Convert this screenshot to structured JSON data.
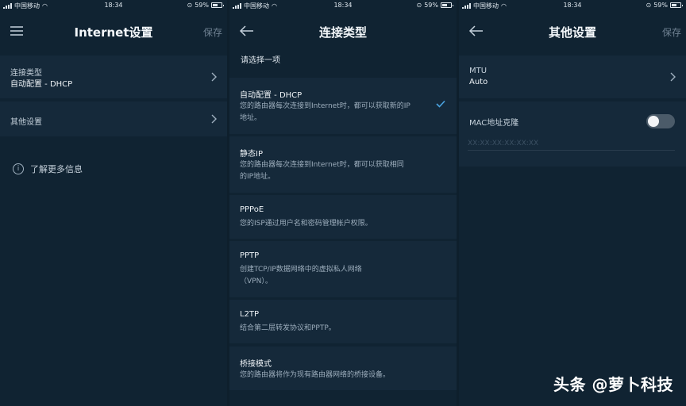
{
  "status_bar": {
    "carrier": "中国移动",
    "time": "18:34",
    "battery": "59%"
  },
  "panel1": {
    "title": "Internet设置",
    "save_label": "保存",
    "connection": {
      "label": "连接类型",
      "value": "自动配置 - DHCP"
    },
    "other_settings_label": "其他设置",
    "learn_more": "了解更多信息"
  },
  "panel2": {
    "title": "连接类型",
    "prompt": "请选择一项",
    "options": [
      {
        "name": "自动配置 - DHCP",
        "desc": "您的路由器每次连接到Internet时，都可以获取新的IP地址。",
        "selected": true
      },
      {
        "name": "静态IP",
        "desc": "您的路由器每次连接到Internet时，都可以获取相同的IP地址。",
        "selected": false
      },
      {
        "name": "PPPoE",
        "desc": "您的ISP通过用户名和密码管理帐户权限。",
        "selected": false
      },
      {
        "name": "PPTP",
        "desc": "创建TCP/IP数据网络中的虚拟私人网络（VPN）。",
        "selected": false
      },
      {
        "name": "L2TP",
        "desc": "结合第二层转发协议和PPTP。",
        "selected": false
      },
      {
        "name": "桥接模式",
        "desc": "您的路由器将作为现有路由器网络的桥接设备。",
        "selected": false
      }
    ]
  },
  "panel3": {
    "title": "其他设置",
    "save_label": "保存",
    "mtu": {
      "label": "MTU",
      "value": "Auto"
    },
    "mac_clone": {
      "label": "MAC地址克隆",
      "enabled": false,
      "placeholder": "XX:XX:XX:XX:XX:XX"
    }
  },
  "watermark": "头条 @萝卜科技",
  "colors": {
    "accent_check": "#4aa3e0",
    "background": "#102332",
    "row": "#15293a"
  }
}
